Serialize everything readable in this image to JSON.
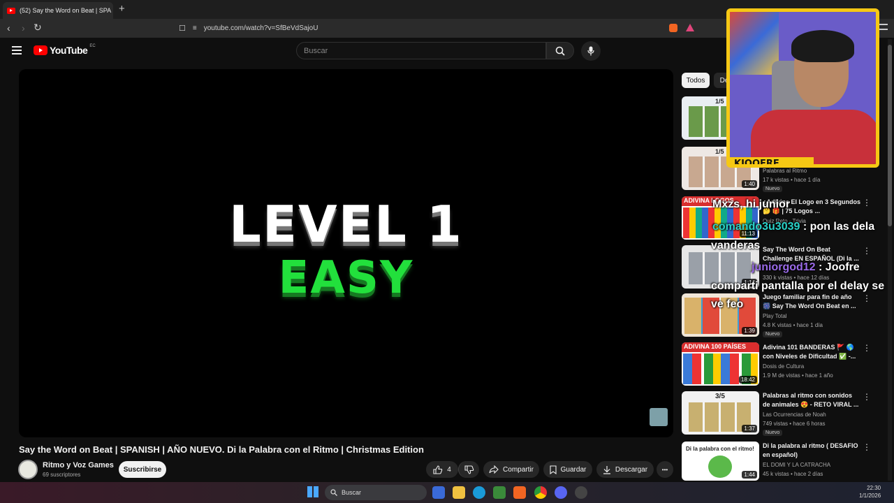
{
  "browser": {
    "tab_title": "(52) Say the Word on Beat | SPA",
    "tab_close": "✕",
    "new_tab": "+",
    "url": "youtube.com/watch?v=SfBeVdSajoU"
  },
  "youtube": {
    "logo_text": "YouTube",
    "country_code": "EC",
    "search_placeholder": "Buscar"
  },
  "player": {
    "line1": "LEVEL 1",
    "line2": "EASY"
  },
  "video": {
    "title": "Say the Word on Beat | SPANISH | AÑO NUEVO. Di la Palabra con el Ritmo | Christmas Edition",
    "channel": "Ritmo y Voz Games",
    "subscribers": "69 suscriptores",
    "subscribe_label": "Suscribirse",
    "likes": "4",
    "share_label": "Compartir",
    "save_label": "Guardar",
    "download_label": "Descargar",
    "more": "•••"
  },
  "sidebar": {
    "chips": [
      "Todos",
      "De"
    ],
    "videos": [
      {
        "title": "",
        "channel": "",
        "meta": "",
        "duration": "",
        "badge": "",
        "thumb_label": "1/5"
      },
      {
        "title": "",
        "channel": "Palabras al Ritmo",
        "meta": "17 k vistas • hace 1 día",
        "duration": "1:40",
        "badge": "Nuevo",
        "thumb_label": "1/5"
      },
      {
        "title": "¿Adivina El Logo en 3 Segundos 🤔 🎁 | 75 Logos ...",
        "channel": "Quiz Reto - Trivia",
        "meta": "",
        "duration": "11:13",
        "badge": "",
        "thumb_label": "ADIVINA LOGOS"
      },
      {
        "title": "Say The Word On Beat Challenge EN ESPAÑOL (Di la ...",
        "channel": "",
        "meta": "330 k vistas • hace 12 días",
        "duration": "1:14",
        "badge": "",
        "thumb_label": ""
      },
      {
        "title": "Juego familiar para fin de año 🎆 Say The Word On Beat en ...",
        "channel": "Play Total",
        "meta": "4.8 K vistas • hace 1 día",
        "duration": "1:39",
        "badge": "Nuevo",
        "thumb_label": ""
      },
      {
        "title": "Adivina 101 BANDERAS 🚩 🌎 con Niveles de Dificultad ✅ -...",
        "channel": "Dosis de Cultura",
        "meta": "1.9 M de vistas • hace 1 año",
        "duration": "18:42",
        "badge": "",
        "thumb_label": "ADIVINA 100 PAÍSES"
      },
      {
        "title": "Palabras al ritmo con sonidos de animales 😍 - RETO VIRAL ...",
        "channel": "Las Ocurrencias de Noah",
        "meta": "749 vistas • hace 6 horas",
        "duration": "1:37",
        "badge": "Nuevo",
        "thumb_label": "3/5"
      },
      {
        "title": "Di la palabra al ritmo ( DESAFIO en español)",
        "channel": "EL DOMI Y LA CATRACHA",
        "meta": "45 k vistas • hace 2 días",
        "duration": "1:44",
        "badge": "",
        "thumb_label": "Di la palabra con el ritmo!"
      }
    ]
  },
  "webcam": {
    "name": "KJOOFRE"
  },
  "chat": [
    {
      "user": "",
      "text": "Mxzs, hi junior"
    },
    {
      "user": "comando3u3039",
      "text": ": pon las dela"
    },
    {
      "user": "",
      "text": "vanderas"
    },
    {
      "user": "juniorgod12",
      "text": ": Joofre"
    },
    {
      "user": "",
      "text": "comparti pantalla por el delay se"
    },
    {
      "user": "",
      "text": "ve feo"
    }
  ],
  "taskbar": {
    "search_label": "Buscar",
    "time": "22:30",
    "date": "1/1/2026"
  }
}
